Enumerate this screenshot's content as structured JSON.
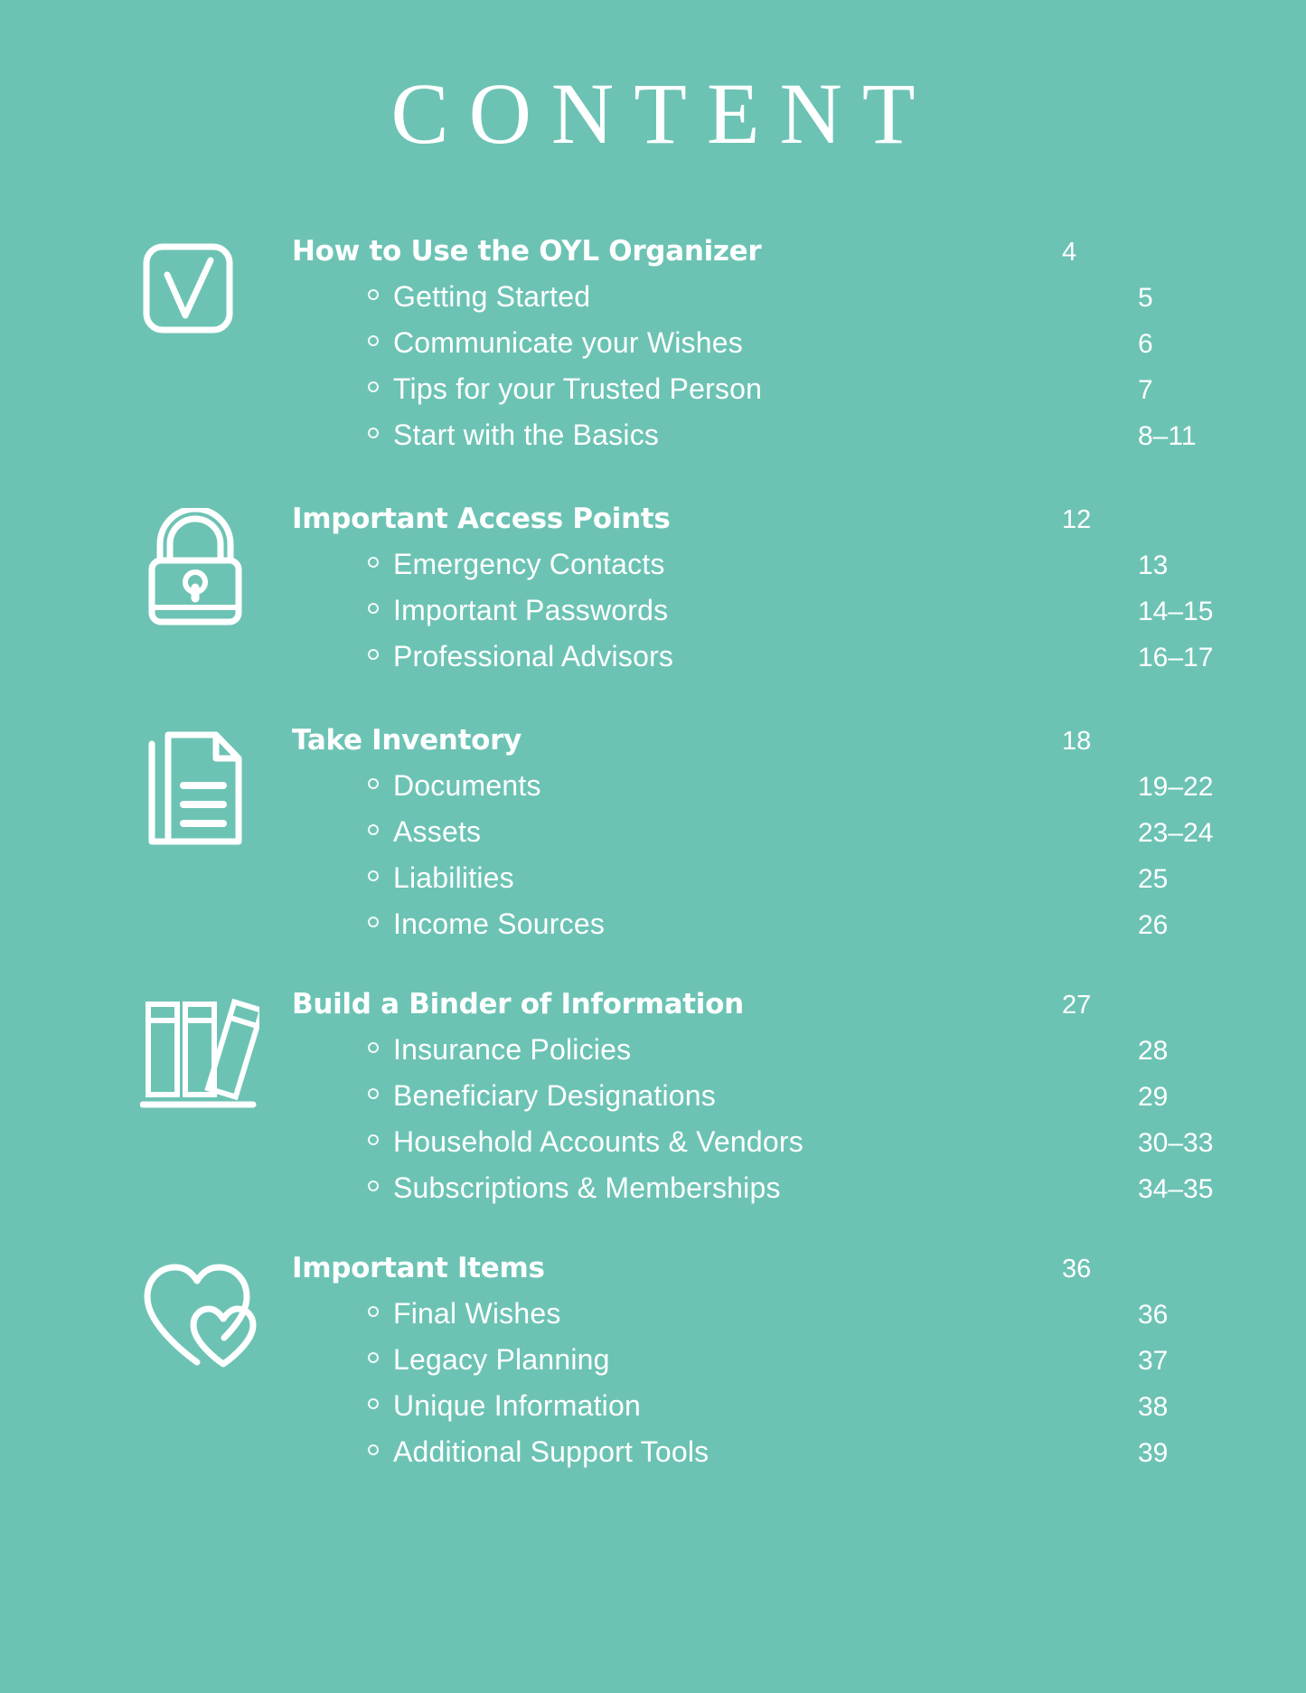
{
  "document": {
    "title": "CONTENT",
    "background_color": "#6CC3B4",
    "text_color": "#FFFFFF"
  },
  "toc": {
    "sections": [
      {
        "icon": "checkbox-check-icon",
        "heading": "How to Use the OYL Organizer",
        "page": "4",
        "items": [
          {
            "label": "Getting Started",
            "page": "5"
          },
          {
            "label": "Communicate your Wishes",
            "page": "6"
          },
          {
            "label": "Tips for your Trusted Person",
            "page": "7"
          },
          {
            "label": "Start with the Basics",
            "page": "8–11"
          }
        ]
      },
      {
        "icon": "padlock-icon",
        "heading": "Important Access Points",
        "page": "12",
        "items": [
          {
            "label": "Emergency Contacts",
            "page": "13"
          },
          {
            "label": "Important Passwords",
            "page": "14–15"
          },
          {
            "label": "Professional Advisors",
            "page": "16–17"
          }
        ]
      },
      {
        "icon": "documents-icon",
        "heading": "Take Inventory",
        "page": "18",
        "items": [
          {
            "label": "Documents",
            "page": "19–22"
          },
          {
            "label": "Assets",
            "page": "23–24"
          },
          {
            "label": "Liabilities",
            "page": "25"
          },
          {
            "label": "Income Sources",
            "page": "26"
          }
        ]
      },
      {
        "icon": "books-shelf-icon",
        "heading": "Build a Binder of Information",
        "page": "27",
        "items": [
          {
            "label": "Insurance Policies",
            "page": "28"
          },
          {
            "label": "Beneficiary Designations",
            "page": "29"
          },
          {
            "label": "Household Accounts & Vendors",
            "page": "30–33"
          },
          {
            "label": "Subscriptions & Memberships",
            "page": "34–35"
          }
        ]
      },
      {
        "icon": "two-hearts-icon",
        "heading": "Important Items",
        "page": "36",
        "items": [
          {
            "label": "Final Wishes",
            "page": "36"
          },
          {
            "label": "Legacy Planning",
            "page": "37"
          },
          {
            "label": "Unique Information",
            "page": "38"
          },
          {
            "label": "Additional Support Tools",
            "page": "39"
          }
        ]
      }
    ]
  }
}
